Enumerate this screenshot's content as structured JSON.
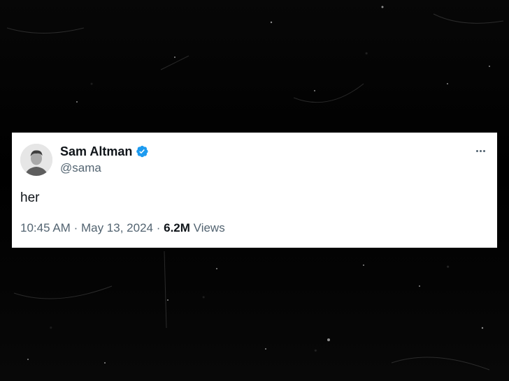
{
  "tweet": {
    "display_name": "Sam Altman",
    "handle": "@sama",
    "verified": true,
    "text": "her",
    "time": "10:45 AM",
    "separator": "·",
    "date": "May 13, 2024",
    "views_count": "6.2M",
    "views_label": "Views",
    "icons": {
      "verified": "verified-badge-icon",
      "more": "more-options-icon"
    }
  },
  "colors": {
    "background": "#050505",
    "card": "#ffffff",
    "text_primary": "#0f1419",
    "text_secondary": "#536471",
    "verified_blue": "#1d9bf0"
  }
}
